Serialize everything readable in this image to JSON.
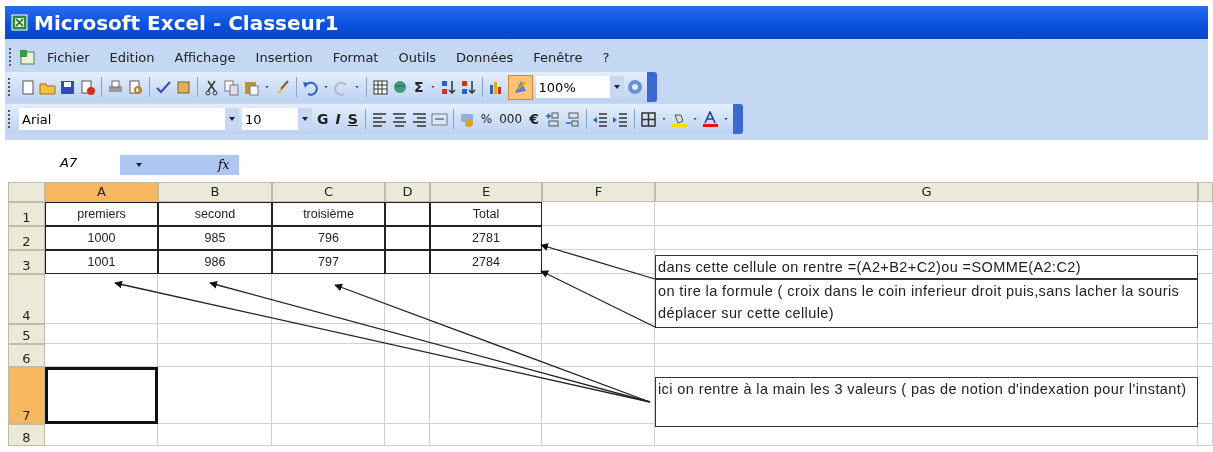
{
  "window": {
    "title": "Microsoft Excel - Classeur1"
  },
  "menu": [
    "Fichier",
    "Edition",
    "Affichage",
    "Insertion",
    "Format",
    "Outils",
    "Données",
    "Fenêtre",
    "?"
  ],
  "standard_toolbar": {
    "autosum": "Σ",
    "zoom": "100%",
    "drawing_pressed": true
  },
  "formatting_toolbar": {
    "font": "Arial",
    "size": "10",
    "bold": "G",
    "italic": "I",
    "underline": "S",
    "percent": "%",
    "thousands": "000",
    "euro": "€"
  },
  "formula_bar": {
    "name_box": "A7",
    "fx": "fx"
  },
  "sheet": {
    "columns": [
      {
        "label": "A",
        "selected": true
      },
      {
        "label": "B",
        "selected": false
      },
      {
        "label": "C",
        "selected": false
      },
      {
        "label": "D",
        "selected": false
      },
      {
        "label": "E",
        "selected": false
      },
      {
        "label": "F",
        "selected": false
      },
      {
        "label": "G",
        "selected": false
      }
    ],
    "rows": [
      {
        "number": "1",
        "selected": false,
        "cells": {
          "A": "premiers",
          "B": "second",
          "C": "troisième",
          "E": "Total"
        }
      },
      {
        "number": "2",
        "selected": false,
        "cells": {
          "A": "1000",
          "B": "985",
          "C": "796",
          "E": "2781"
        }
      },
      {
        "number": "3",
        "selected": false,
        "cells": {
          "A": "1001",
          "B": "986",
          "C": "797",
          "E": "2784"
        }
      },
      {
        "number": "4",
        "selected": false,
        "cells": {}
      },
      {
        "number": "5",
        "selected": false,
        "cells": {}
      },
      {
        "number": "6",
        "selected": false,
        "cells": {}
      },
      {
        "number": "7",
        "selected": true,
        "cells": {}
      },
      {
        "number": "8",
        "selected": false,
        "cells": {}
      }
    ],
    "text_boxes": [
      "dans cette cellule on rentre =(A2+B2+C2)ou =SOMME(A2:C2)",
      "on tire la formule ( croix dans le coin inferieur droit puis,sans lacher la souris déplacer sur cette cellule)",
      "ici on rentre à la main les 3 valeurs ( pas de notion d'indexation pour l'instant)"
    ]
  }
}
